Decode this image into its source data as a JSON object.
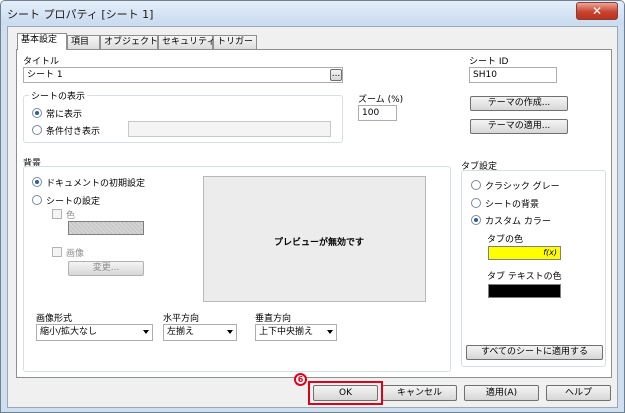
{
  "window": {
    "title": "シート プロパティ [シート 1]",
    "close_glyph": "✕"
  },
  "tabs": [
    {
      "label": "基本設定"
    },
    {
      "label": "項目"
    },
    {
      "label": "オブジェクト"
    },
    {
      "label": "セキュリティ"
    },
    {
      "label": "トリガー"
    }
  ],
  "title_field": {
    "label": "タイトル",
    "value": "シート 1",
    "browse": "..."
  },
  "sheet_id": {
    "label": "シート ID",
    "value": "SH10"
  },
  "display": {
    "group": "シートの表示",
    "always": "常に表示",
    "conditional": "条件付き表示",
    "condition_value": ""
  },
  "zoom": {
    "label": "ズーム (%)",
    "value": "100"
  },
  "theme": {
    "create": "テーマの作成...",
    "apply": "テーマの適用..."
  },
  "background": {
    "group": "背景",
    "doc_default": "ドキュメントの初期設定",
    "sheet_setting": "シートの設定",
    "color": "色",
    "image": "画像",
    "change": "変更...",
    "preview": "プレビューが無効です"
  },
  "image_format": {
    "label": "画像形式",
    "value": "縮小/拡大なし"
  },
  "h_align": {
    "label": "水平方向",
    "value": "左揃え"
  },
  "v_align": {
    "label": "垂直方向",
    "value": "上下中央揃え"
  },
  "tab_settings": {
    "group": "タブ設定",
    "classic_gray": "クラシック グレー",
    "sheet_bg": "シートの背景",
    "custom": "カスタム カラー",
    "tab_color": "タブの色",
    "tab_color_fx": "f(x)",
    "tab_color_hex": "#ffff00",
    "text_color": "タブ テキストの色",
    "text_color_hex": "#000000",
    "apply_all": "すべてのシートに適用する"
  },
  "footer": {
    "ok": "OK",
    "cancel": "キャンセル",
    "apply": "適用(A)",
    "help": "ヘルプ"
  },
  "annotation": {
    "step": "6",
    "color": "#e0001a"
  }
}
